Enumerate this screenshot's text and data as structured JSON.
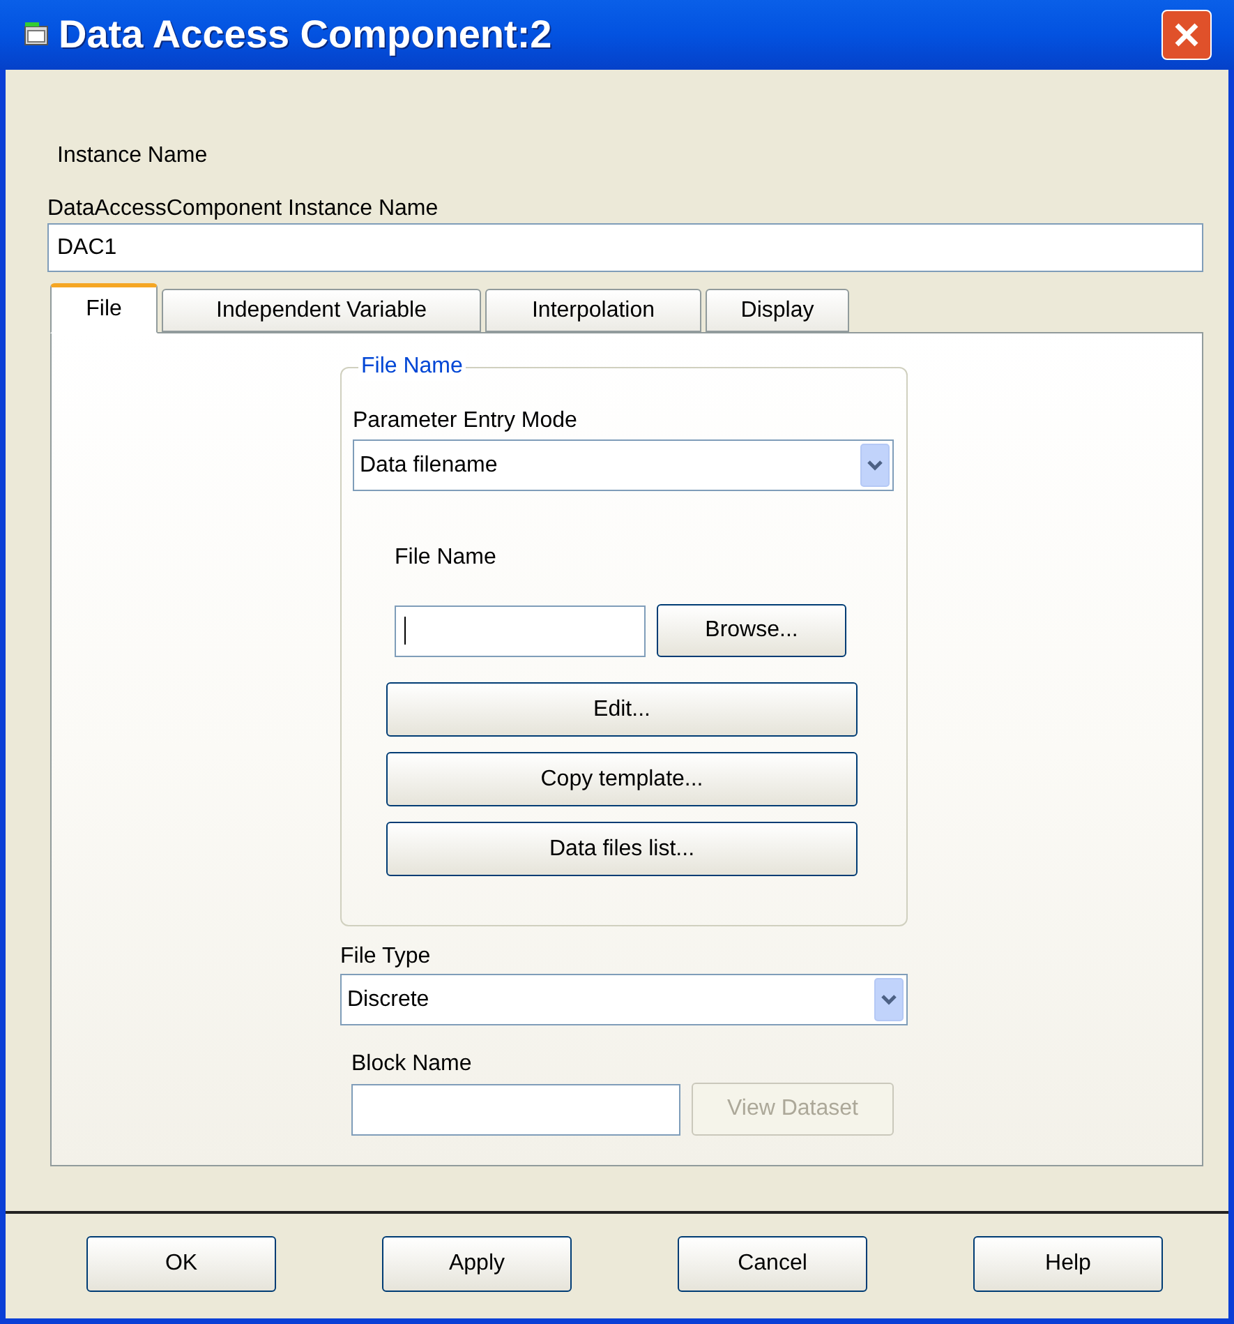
{
  "window": {
    "title": "Data Access Component:2"
  },
  "instance_section": {
    "heading": "Instance Name",
    "field_label": "DataAccessComponent Instance Name",
    "value": "DAC1"
  },
  "tabs": [
    {
      "label": "File",
      "selected": true
    },
    {
      "label": "Independent Variable",
      "selected": false
    },
    {
      "label": "Interpolation",
      "selected": false
    },
    {
      "label": "Display",
      "selected": false
    }
  ],
  "file_name_group": {
    "legend": "File Name",
    "entry_mode_label": "Parameter Entry Mode",
    "entry_mode_value": "Data filename",
    "file_name_label": "File Name",
    "browse_button": "Browse...",
    "buttons": [
      "Edit...",
      "Copy template...",
      "Data files list..."
    ]
  },
  "file_type": {
    "label": "File Type",
    "value": "Discrete"
  },
  "block_name": {
    "label": "Block Name",
    "view_button": {
      "label": "View Dataset",
      "disabled": true
    }
  },
  "buttons": [
    "OK",
    "Apply",
    "Cancel",
    "Help"
  ]
}
